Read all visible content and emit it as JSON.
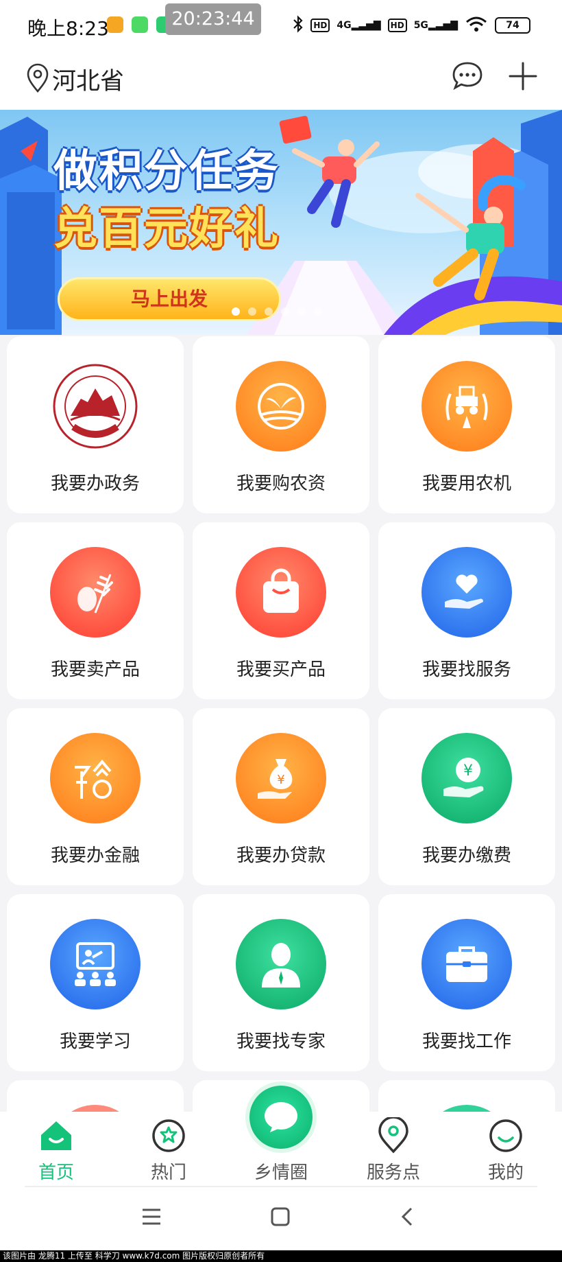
{
  "status_bar": {
    "time": "晚上8:23",
    "overlay_clock": "20:23:44",
    "net1": "4G",
    "net2": "5G",
    "hd": "HD",
    "battery": "74"
  },
  "header": {
    "location": "河北省"
  },
  "banner": {
    "title_line1": "做积分任务",
    "title_line2": "兑百元好礼",
    "button": "马上出发",
    "current_slide": 1,
    "slide_count": 6
  },
  "grid": [
    {
      "label": "我要办政务",
      "icon": "hebei-government-seal-icon",
      "color": "#b8232b"
    },
    {
      "label": "我要购农资",
      "icon": "sprout-icon",
      "color": "#ff7a18"
    },
    {
      "label": "我要用农机",
      "icon": "tractor-icon",
      "color": "#ff7a18"
    },
    {
      "label": "我要卖产品",
      "icon": "wheat-icon",
      "color": "#ff4a3c"
    },
    {
      "label": "我要买产品",
      "icon": "shopping-bag-icon",
      "color": "#ff4a3c"
    },
    {
      "label": "我要找服务",
      "icon": "heart-hand-icon",
      "color": "#2e7cf6"
    },
    {
      "label": "我要办金融",
      "icon": "finance-yu-icon",
      "color": "#ff7a18"
    },
    {
      "label": "我要办贷款",
      "icon": "money-bag-icon",
      "color": "#ff7a18"
    },
    {
      "label": "我要办缴费",
      "icon": "yen-hand-icon",
      "color": "#14c27a"
    },
    {
      "label": "我要学习",
      "icon": "classroom-icon",
      "color": "#2e7cf6"
    },
    {
      "label": "我要找专家",
      "icon": "expert-person-icon",
      "color": "#14c27a"
    },
    {
      "label": "我要找工作",
      "icon": "briefcase-icon",
      "color": "#2e7cf6"
    }
  ],
  "bottom_nav": [
    {
      "label": "首页",
      "icon": "home-icon",
      "active": true
    },
    {
      "label": "热门",
      "icon": "hot-flower-icon",
      "active": false
    },
    {
      "label": "乡情圈",
      "icon": "chat-bubble-icon",
      "active": false
    },
    {
      "label": "服务点",
      "icon": "map-pin-icon",
      "active": false
    },
    {
      "label": "我的",
      "icon": "smile-face-icon",
      "active": false
    }
  ],
  "footer_text": "该图片由 龙腾11 上传至 科学刀 www.k7d.com 图片版权归原创者所有",
  "colors": {
    "accent": "#14c27a",
    "orange": "#ff7a18",
    "red": "#ff4a3c",
    "blue": "#2e7cf6"
  }
}
